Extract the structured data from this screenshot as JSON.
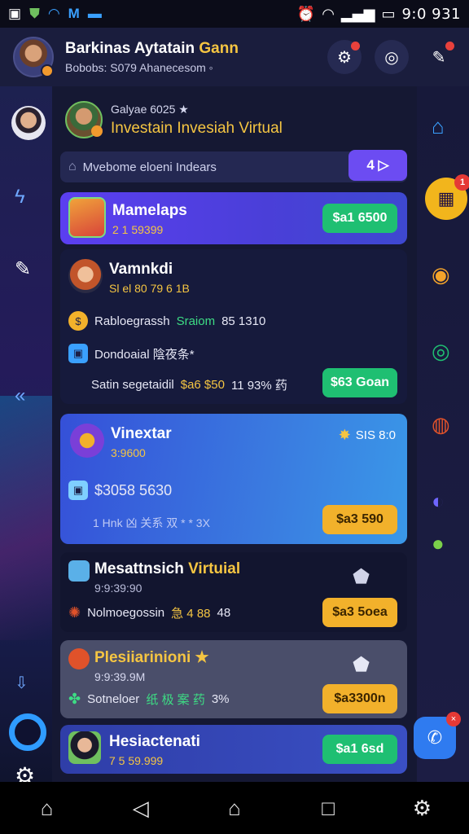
{
  "status": {
    "time": "9:0 931",
    "left_icons": [
      "image-icon",
      "shield-icon",
      "wifi-icon",
      "m-app-icon",
      "dots-icon"
    ],
    "right_icons": [
      "alarm-icon",
      "wifi-icon",
      "signal-icon",
      "battery-icon"
    ]
  },
  "header": {
    "title_prefix": "Barkinas Aytatain",
    "title_accent": "Gann",
    "subtitle": "Bobobs: S079 Ahanecesom ◦",
    "actions": [
      "notification-gear-icon",
      "target-icon",
      "chat-icon"
    ]
  },
  "promo": {
    "small": "Galyae 6025 ★",
    "title": "Investain Invesiah Virtual"
  },
  "filter": {
    "label": "Mvebome eloeni Indears",
    "button": "4 ▷"
  },
  "cards": [
    {
      "title": "Mamelaps",
      "sub": "2 1 59399",
      "cta": "$a1 6500"
    },
    {
      "title": "Vamnkdi",
      "sub": "Sl el 80 79 6 1B",
      "line1_prefix": "Rabloegrassh",
      "line1_accent": "Sraiom",
      "line1_suffix": "85 1310",
      "line2": "Dondoaial 陰夜条*",
      "line3_prefix": "Satin segetaidil",
      "line3_accent": "$a6 $50",
      "line3_suffix": "11 93% 药",
      "cta": "$63 Goan"
    },
    {
      "title": "Vinextar",
      "sub": "3:9600",
      "corner": "SIS 8:0",
      "amount": "$3058 5630",
      "meta": "1 Hnk 凶 关系 双 * *  3X",
      "cta": "$a3 590"
    },
    {
      "title_prefix": "Mesattnsich",
      "title_accent": "Virtuial",
      "sub": "9:9:39:90",
      "line": "Nolmoegossin",
      "line_accent": "急 4 88",
      "line_suffix": "48",
      "cta": "$a3 5oea"
    },
    {
      "title": "Plesiiarinioni ★",
      "sub": "9:9:39.9M",
      "line": "Sotneloer",
      "line_accent": "纸 极 案 药",
      "line_suffix": "3%",
      "cta": "$a3300n"
    },
    {
      "title": "Hesiactenati",
      "sub": "7 5 59.999",
      "cta": "$a1 6sd"
    }
  ],
  "colors": {
    "accent_purple": "#6c4cf2",
    "accent_green": "#1fbf72",
    "accent_orange": "#f2b12b",
    "accent_yellow": "#f5c542",
    "card_dark": "#1b1f47",
    "card_gradient_blue": "#3a63d8"
  },
  "nav": [
    "home-icon",
    "back-icon",
    "home-outline-icon",
    "recents-icon",
    "settings-gear-icon"
  ]
}
